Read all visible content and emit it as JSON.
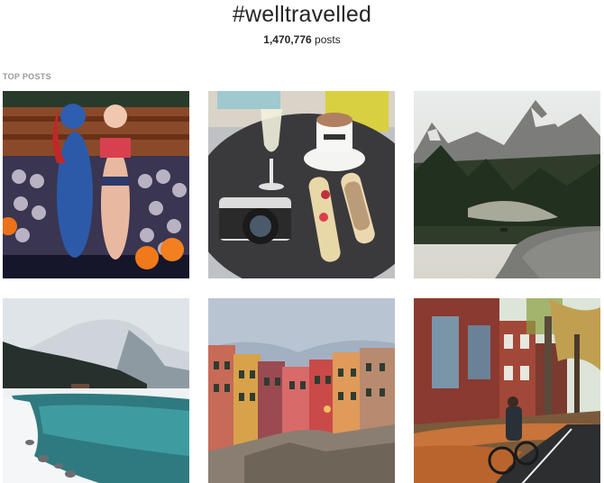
{
  "header": {
    "hashtag": "#welltravelled",
    "post_count": "1,470,776",
    "post_count_suffix": " posts"
  },
  "sections": {
    "top_posts_label": "TOP POSTS"
  },
  "posts": [
    {
      "subject": "Halloween costumes in front of skull wall with pumpkins"
    },
    {
      "subject": "Cafe table with coffee, wine glass, film camera and eclairs"
    },
    {
      "subject": "Mountain valley with forest road and river at sunrise"
    },
    {
      "subject": "Snowy alpine lake with turquoise water and misty mountains"
    },
    {
      "subject": "Colorful Italian seaside houses under cloudy sky"
    },
    {
      "subject": "Autumn street with brick townhouses and cyclist"
    }
  ]
}
